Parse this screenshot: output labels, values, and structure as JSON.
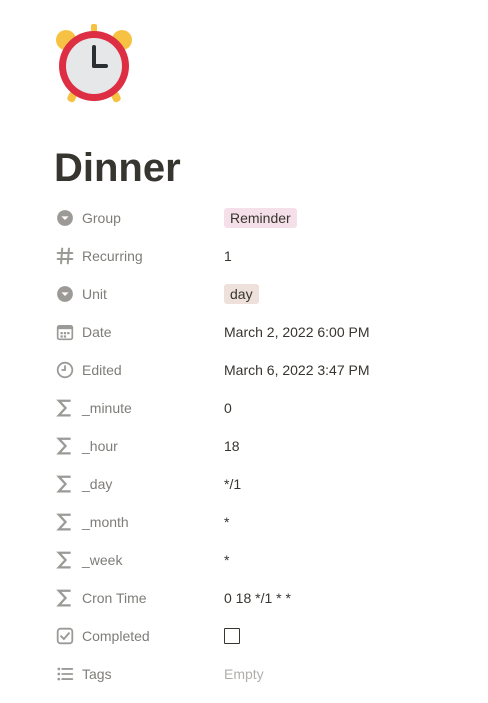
{
  "page": {
    "icon": "alarm-clock-icon",
    "title": "Dinner"
  },
  "properties": [
    {
      "name": "Group",
      "icon": "select-icon",
      "value": "Reminder",
      "type": "tag",
      "color": "#f5e0e9"
    },
    {
      "name": "Recurring",
      "icon": "number-icon",
      "value": "1",
      "type": "text"
    },
    {
      "name": "Unit",
      "icon": "select-icon",
      "value": "day",
      "type": "tag",
      "color": "#eee0da"
    },
    {
      "name": "Date",
      "icon": "calendar-icon",
      "value": "March 2, 2022 6:00 PM",
      "type": "text"
    },
    {
      "name": "Edited",
      "icon": "clock-icon",
      "value": "March 6, 2022 3:47 PM",
      "type": "text"
    },
    {
      "name": "_minute",
      "icon": "formula-icon",
      "value": "0",
      "type": "text"
    },
    {
      "name": "_hour",
      "icon": "formula-icon",
      "value": "18",
      "type": "text"
    },
    {
      "name": "_day",
      "icon": "formula-icon",
      "value": "*/1",
      "type": "text"
    },
    {
      "name": "_month",
      "icon": "formula-icon",
      "value": "*",
      "type": "text"
    },
    {
      "name": "_week",
      "icon": "formula-icon",
      "value": "*",
      "type": "text"
    },
    {
      "name": "Cron Time",
      "icon": "formula-icon",
      "value": "0 18 */1 * *",
      "type": "text"
    },
    {
      "name": "Completed",
      "icon": "checkbox-icon",
      "value": "",
      "checked": false,
      "type": "checkbox"
    },
    {
      "name": "Tags",
      "icon": "list-icon",
      "value": "Empty",
      "type": "empty"
    }
  ]
}
